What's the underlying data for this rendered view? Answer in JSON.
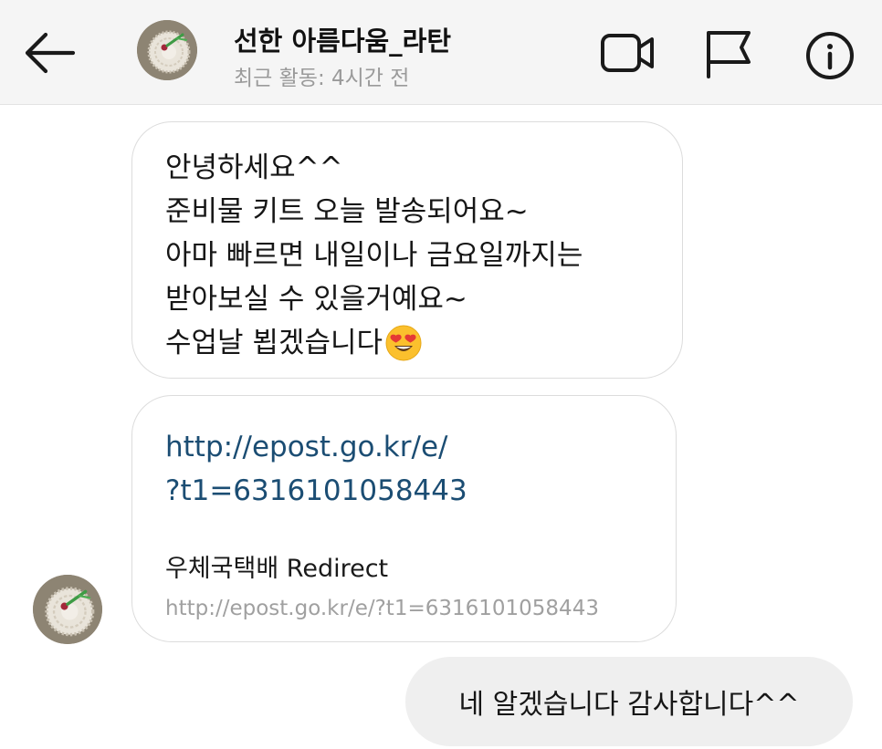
{
  "header": {
    "contact_name": "선한 아름다움_라탄",
    "last_active": "최근 활동: 4시간 전",
    "icons": [
      "back-arrow-icon",
      "video-call-icon",
      "flag-icon",
      "info-icon"
    ]
  },
  "messages": {
    "received_text": {
      "lines": [
        "안녕하세요^^",
        "준비물 키트 오늘 발송되어요~",
        "아마 빠르면 내일이나 금요일까지는",
        "받아보실 수 있을거예요~",
        "수업날 뵙겠습니다"
      ],
      "trailing_emoji": "smiling-face-with-heart-eyes"
    },
    "received_link": {
      "url_line1": "http://epost.go.kr/e/",
      "url_line2": "?t1=6316101058443",
      "preview_title": "우체국택배 Redirect",
      "preview_url": "http://epost.go.kr/e/?t1=6316101058443"
    },
    "sent_text": "네 알겠습니다 감사합니다^^"
  },
  "colors": {
    "header_bg": "#f5f5f5",
    "link": "#1b4d73",
    "muted": "#9a9a9a",
    "sent_bubble": "#efefef",
    "received_border": "#dcdcdc"
  }
}
